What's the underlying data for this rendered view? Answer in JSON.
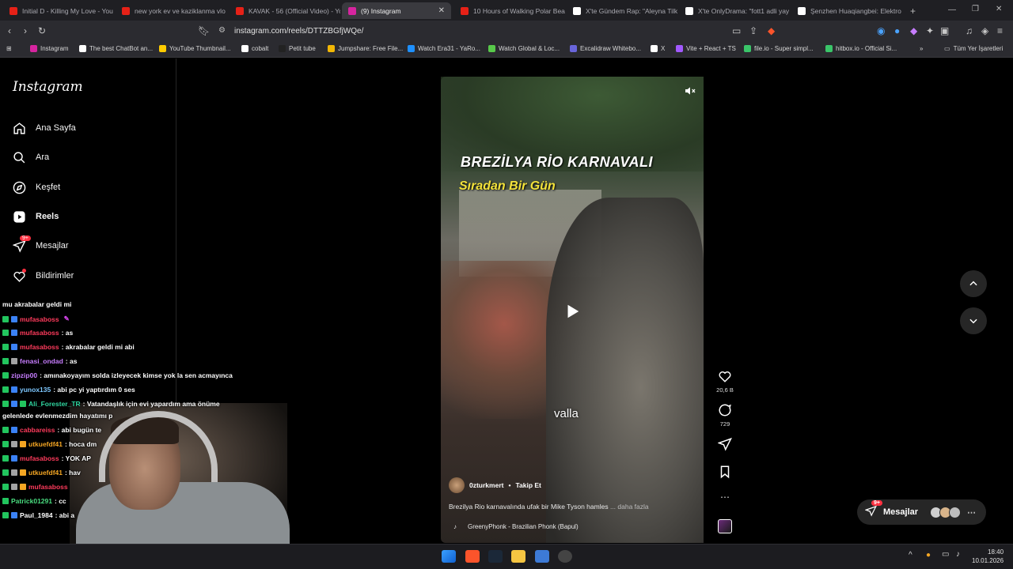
{
  "browser": {
    "tabs": [
      {
        "label": "Initial D - Killing My Love - You",
        "color": "#e62117"
      },
      {
        "label": "new york ev ve kaziklanma vlo",
        "color": "#e62117"
      },
      {
        "label": "KAVAK - 56 (Official Video) - Yo",
        "color": "#e62117"
      },
      {
        "label": "(9) Instagram",
        "color": "#d6249f",
        "active": true
      },
      {
        "label": "10 Hours of Walking Polar Bea",
        "color": "#e62117"
      },
      {
        "label": "X'te Gündem Rap: \"Aleyna Tilk",
        "color": "#ffffff"
      },
      {
        "label": "X'te OnlyDrama: \"fott1 adli yay",
        "color": "#ffffff"
      },
      {
        "label": "Şenzhen Huaqiangbei: Elektro",
        "color": "#ffffff"
      }
    ],
    "url": "instagram.com/reels/DTTZBGfjWQe/",
    "bookmarks": [
      {
        "label": "Instagram",
        "color": "#d6249f"
      },
      {
        "label": "The best ChatBot an...",
        "color": "#ffffff"
      },
      {
        "label": "YouTube Thumbnail...",
        "color": "#ffcc00"
      },
      {
        "label": "cobalt",
        "color": "#ffffff"
      },
      {
        "label": "Petit tube",
        "color": "#222222"
      },
      {
        "label": "Jumpshare: Free File...",
        "color": "#f2b705"
      },
      {
        "label": "Watch Era31 - YaRo...",
        "color": "#1e90ff"
      },
      {
        "label": "Watch Global & Loc...",
        "color": "#58c94a"
      },
      {
        "label": "Excalidraw Whitebo...",
        "color": "#6965db"
      },
      {
        "label": "X",
        "color": "#ffffff"
      },
      {
        "label": "Vite + React + TS",
        "color": "#a259ff"
      },
      {
        "label": "file.io - Super simpl...",
        "color": "#3ac569"
      },
      {
        "label": "hitbox.io - Official Si...",
        "color": "#3ac569"
      }
    ],
    "all_bookmarks": "Tüm Yer İşaretleri"
  },
  "sidebar": {
    "logo": "Instagram",
    "items": [
      {
        "label": "Ana Sayfa",
        "icon": "home-icon"
      },
      {
        "label": "Ara",
        "icon": "search-icon"
      },
      {
        "label": "Keşfet",
        "icon": "compass-icon"
      },
      {
        "label": "Reels",
        "icon": "reels-icon"
      },
      {
        "label": "Mesajlar",
        "icon": "messenger-icon",
        "badge": "9+"
      },
      {
        "label": "Bildirimler",
        "icon": "heart-icon"
      }
    ]
  },
  "reel": {
    "title_line1": "BREZİLYA RİO KARNAVALI",
    "title_line2": "Sıradan Bir Gün",
    "subtitle": "valla",
    "author": "0zturkmert",
    "follow": "Takip Et",
    "caption": "Brezilya Rio karnavalında ufak bir Mike Tyson hamles",
    "caption_more": "... daha fazla",
    "music": "GreenyPhonk - Brazilian Phonk (Bapul)",
    "likes": "20,6 B",
    "comments": "729"
  },
  "messages_pill": {
    "label": "Mesajlar",
    "badge": "9+"
  },
  "chat": [
    {
      "user": "",
      "text": "mu akrabalar geldi mi",
      "color": "#ffffff"
    },
    {
      "user": "mufasaboss",
      "text": "",
      "color": "#ff3b5c"
    },
    {
      "user": "mufasaboss",
      "text": ": as",
      "color": "#ff3b5c"
    },
    {
      "user": "mufasaboss",
      "text": ": akrabalar geldi mi abi",
      "color": "#ff3b5c"
    },
    {
      "user": "fenasi_ondad",
      "text": ": as",
      "color": "#c77dff"
    },
    {
      "user": "zipzip00",
      "text": ": amınakoyayım solda izleyecek kimse yok la sen acmayınca",
      "color": "#c77dff"
    },
    {
      "user": "yunox135",
      "text": ": abi pc yi yaptırdım 0 ses",
      "color": "#7ec8ff"
    },
    {
      "user": "Ali_Forester_TR",
      "text": ": Vatandaşlık için evi yapardım ama önüme",
      "color": "#2fd6a0"
    },
    {
      "user": "",
      "text": "gelenlede evlenmezdim hayatımı p",
      "color": "#ffffff"
    },
    {
      "user": "cabbareiss",
      "text": ": abi bugün te",
      "color": "#ff3b5c"
    },
    {
      "user": "utkuefdf41",
      "text": ": hoca dm",
      "color": "#f5a623"
    },
    {
      "user": "mufasaboss",
      "text": ": YOK AP",
      "color": "#ff3b5c"
    },
    {
      "user": "utkuefdf41",
      "text": ": hav",
      "color": "#f5a623"
    },
    {
      "user": "mufasaboss",
      "text": "",
      "color": "#ff3b5c"
    },
    {
      "user": "Patrick01291",
      "text": ": cc",
      "color": "#4ade80"
    },
    {
      "user": "Paul_1984",
      "text": ": abi a",
      "color": "#ffffff"
    }
  ],
  "taskbar": {
    "time": "18:40",
    "date": "10.01.2026"
  }
}
